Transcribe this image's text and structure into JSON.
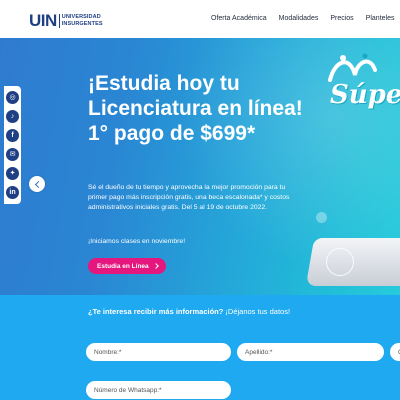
{
  "header": {
    "logo": {
      "mark": "UIN",
      "line1": "UNIVERSIDAD",
      "line2": "INSURGENTES"
    },
    "nav": [
      "Oferta Académica",
      "Modalidades",
      "Precios",
      "Planteles"
    ]
  },
  "hero": {
    "title": "¡Estudia hoy tu Licenciatura en línea! 1° pago de $699*",
    "description": "Sé el dueño de tu tiempo y aprovecha la mejor promoción para tu primer pago más inscripción gratis, una beca escalonada* y costos administrativos iniciales gratis. Del 5 al 19 de octubre 2022.",
    "note": "¡Iniciamos clases en noviembre!",
    "cta_label": "Estudia en Línea",
    "badge_text": "Súpe",
    "colors": {
      "accent": "#e5177f",
      "gradient_start": "#2f7bd0",
      "gradient_end": "#27cadc"
    }
  },
  "social": [
    {
      "icon": "instagram-icon",
      "glyph": "◎"
    },
    {
      "icon": "tiktok-icon",
      "glyph": "♪"
    },
    {
      "icon": "facebook-icon",
      "glyph": "f"
    },
    {
      "icon": "email-icon",
      "glyph": "✉"
    },
    {
      "icon": "twitter-icon",
      "glyph": "✦"
    },
    {
      "icon": "linkedin-icon",
      "glyph": "in"
    }
  ],
  "form": {
    "title_bold": "¿Te interesa recibir más información?",
    "title_rest": " ¡Déjanos tus datos!",
    "name_placeholder": "Nombre:*",
    "lastname_placeholder": "Apellido:*",
    "extra_placeholder": "C",
    "whatsapp_placeholder": "Número de Whatsapp:*",
    "colors": {
      "background": "#1fa9f0"
    }
  }
}
